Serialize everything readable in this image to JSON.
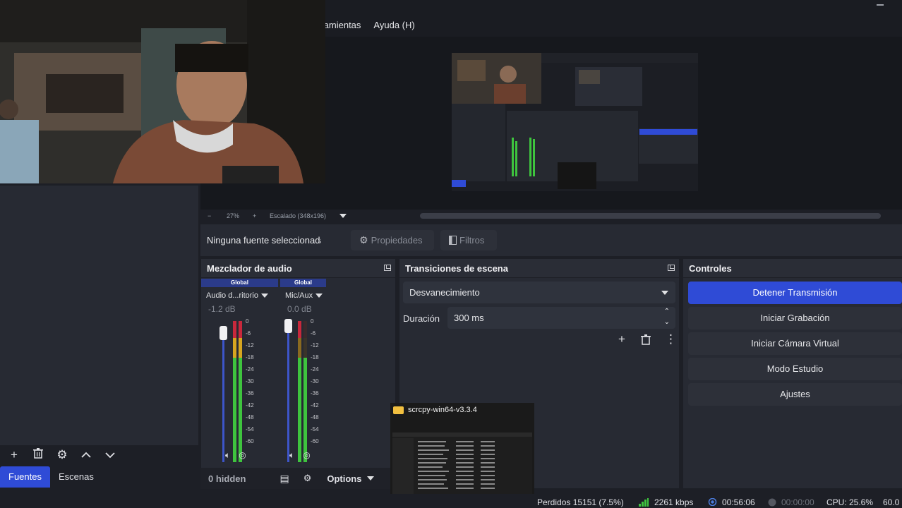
{
  "menu": {
    "items": [
      "rramientas",
      "Ayuda (H)"
    ]
  },
  "zoom": {
    "minus": "−",
    "level": "27%",
    "plus": "+",
    "scaling": "Escalado (348x196)"
  },
  "properties_bar": {
    "no_source": "Ninguna fuente seleccionada",
    "properties_label": "Propiedades",
    "filters_label": "Filtros"
  },
  "mixer": {
    "title": "Mezclador de audio",
    "channels": [
      {
        "scope": "Global",
        "name": "Audio d...ritorio",
        "db": "-1.2 dB"
      },
      {
        "scope": "Global",
        "name": "Mic/Aux",
        "db": "0.0 dB"
      }
    ],
    "ticks": [
      "0",
      "-6",
      "-12",
      "-18",
      "-24",
      "-30",
      "-36",
      "-42",
      "-48",
      "-54",
      "-60"
    ],
    "hidden_label": "0 hidden",
    "options_label": "Options"
  },
  "transitions": {
    "title": "Transiciones de escena",
    "selected": "Desvanecimiento",
    "duration_label": "Duración",
    "duration_value": "300 ms"
  },
  "controls": {
    "title": "Controles",
    "buttons": [
      "Detener Transmisión",
      "Iniciar Grabación",
      "Iniciar Cámara Virtual",
      "Modo Estudio",
      "Ajustes"
    ]
  },
  "dock_tabs": [
    "Fuentes",
    "Escenas"
  ],
  "popup": {
    "title": "scrcpy-win64-v3.3.4"
  },
  "status": {
    "dropped": "Perdidos 15151 (7.5%)",
    "bitrate": "2261 kbps",
    "stream_time": "00:56:06",
    "rec_time": "00:00:00",
    "cpu": "CPU: 25.6%",
    "fps": "60.0"
  },
  "colors": {
    "accent": "#2f4bd6",
    "panel": "#272a33",
    "background": "#1d1f26",
    "meter_green": "#3ec43e",
    "meter_yellow": "#d6a520",
    "meter_red": "#c8283c"
  }
}
